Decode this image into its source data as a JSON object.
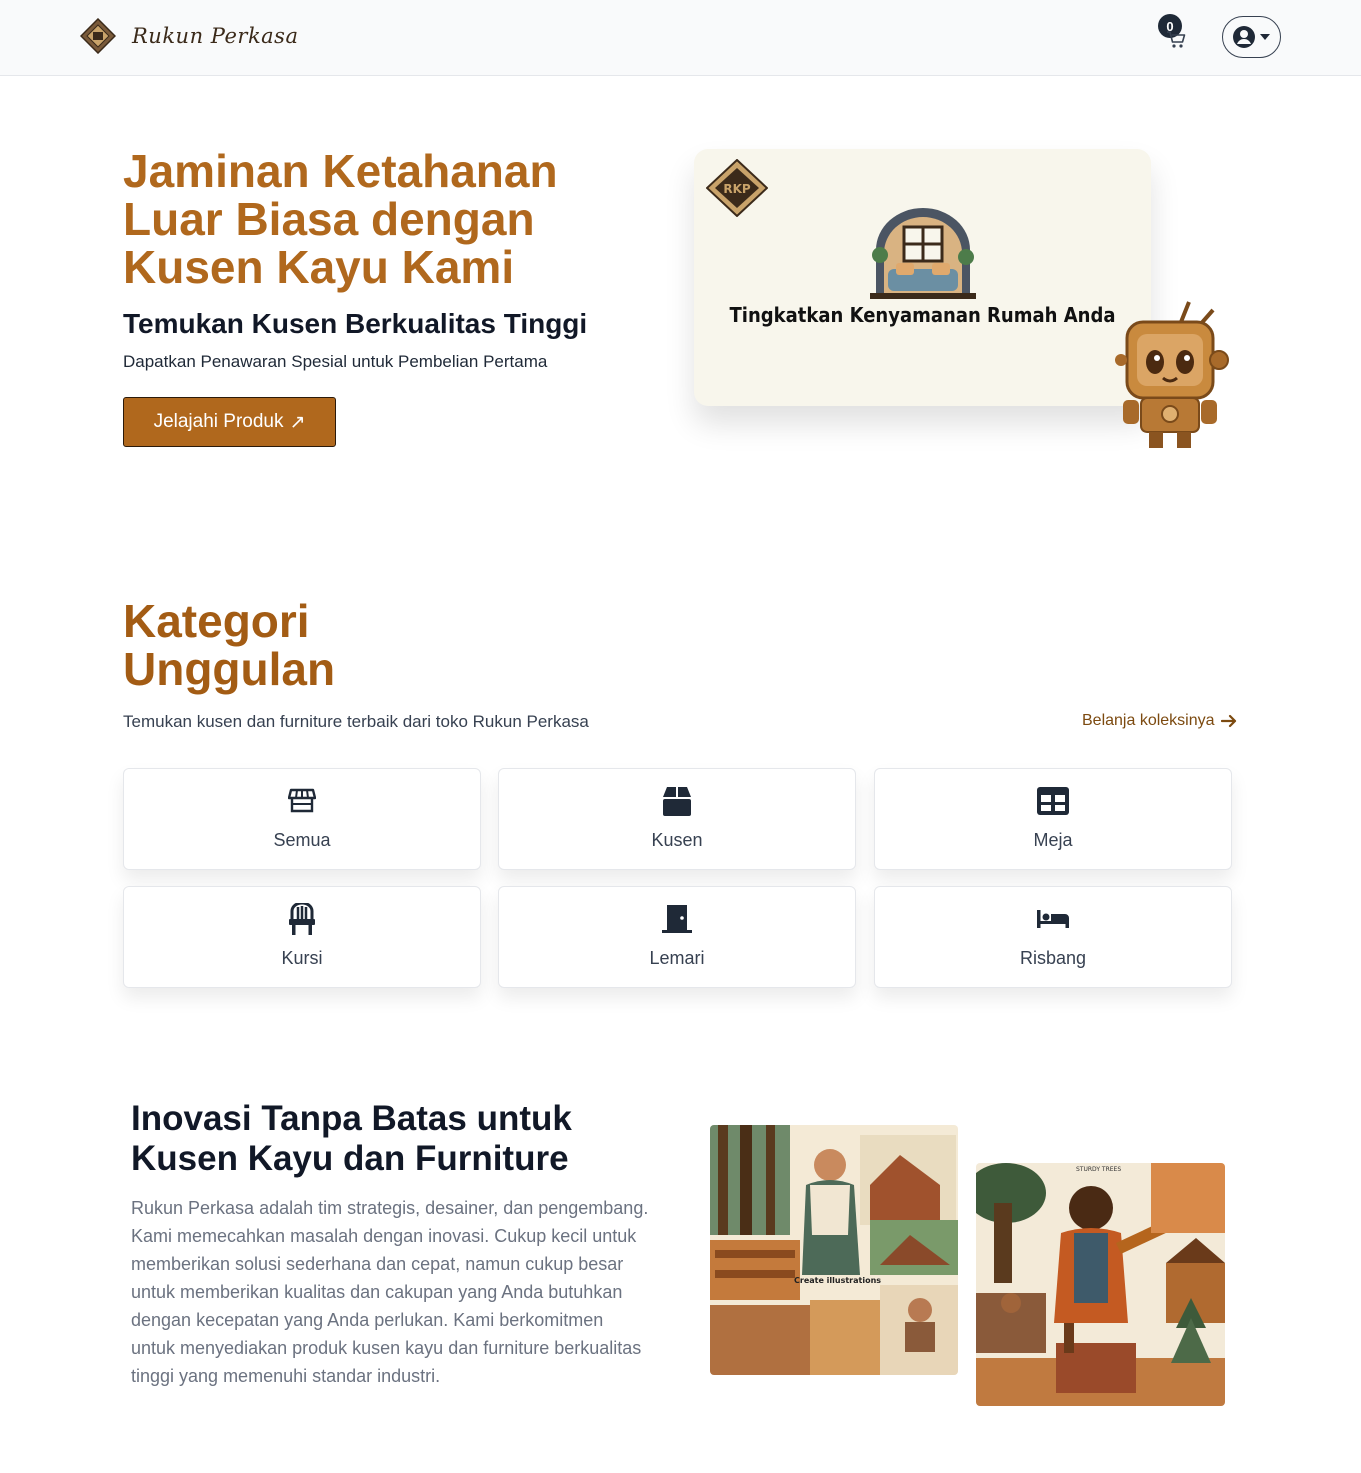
{
  "navbar": {
    "brand_name": "Rukun Perkasa",
    "cart_count": "0"
  },
  "hero": {
    "title": "Jaminan Ketahanan Luar Biasa dengan Kusen Kayu Kami",
    "subtitle": "Temukan Kusen Berkualitas Tinggi",
    "description": "Dapatkan Penawaran Spesial untuk Pembelian Pertama",
    "cta_label": "Jelajahi Produk",
    "cta_icon": "↗",
    "banner_text": "Tingkatkan Kenyamanan Rumah Anda",
    "banner_logo_text": "RKP"
  },
  "categories": {
    "title": "Kategori Unggulan",
    "description": "Temukan kusen dan furniture terbaik dari toko Rukun Perkasa",
    "link_label": "Belanja koleksinya",
    "items": [
      {
        "label": "Semua",
        "icon": "store-icon"
      },
      {
        "label": "Kusen",
        "icon": "box-icon"
      },
      {
        "label": "Meja",
        "icon": "table-icon"
      },
      {
        "label": "Kursi",
        "icon": "chair-icon"
      },
      {
        "label": "Lemari",
        "icon": "door-icon"
      },
      {
        "label": "Risbang",
        "icon": "bed-icon"
      }
    ]
  },
  "about": {
    "title": "Inovasi Tanpa Batas untuk Kusen Kayu dan Furniture",
    "text": "Rukun Perkasa adalah tim strategis, desainer, dan pengembang. Kami memecahkan masalah dengan inovasi. Cukup kecil untuk memberikan solusi sederhana dan cepat, namun cukup besar untuk memberikan kualitas dan cakupan yang Anda butuhkan dengan kecepatan yang Anda perlukan. Kami berkomitmen untuk menyediakan produk kusen kayu dan furniture berkualitas tinggi yang memenuhi standar industri.",
    "image1_caption": "Create illustrations",
    "image2_caption": "STURDY TREES"
  },
  "colors": {
    "accent": "#b0681d",
    "accent_dark": "#a35c14",
    "text_dark": "#111827",
    "muted": "#6b7280"
  }
}
